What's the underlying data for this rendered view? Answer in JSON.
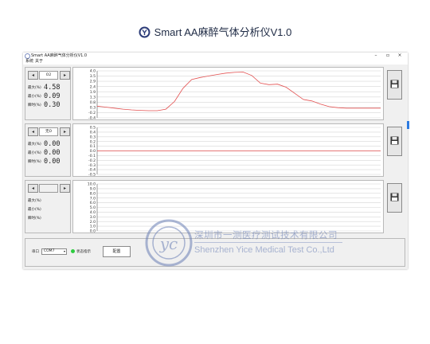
{
  "page": {
    "title": "Smart AA麻醉气体分析仪V1.0"
  },
  "window": {
    "title": "Smart AA麻醉气体分析仪V1.0",
    "controls": [
      "–",
      "▫",
      "×"
    ],
    "menu": [
      "系统",
      "关于"
    ]
  },
  "labels": {
    "max": "最大(%)",
    "min": "最小(%)",
    "instant": "瞬时(%)"
  },
  "channels": [
    {
      "gas": "O2",
      "max": "4.58",
      "min": "0.09",
      "instant": "0.30",
      "ticks": [
        "4.0",
        "3.5",
        "2.9",
        "2.4",
        "1.9",
        "1.3",
        "0.8",
        "0.3",
        "-0.2",
        "-0.4"
      ]
    },
    {
      "gas": "无O",
      "max": "0.00",
      "min": "0.00",
      "instant": "0.00",
      "ticks": [
        "0.5",
        "0.4",
        "0.3",
        "0.2",
        "0.1",
        "0.0",
        "-0.1",
        "-0.2",
        "-0.3",
        "-0.4",
        "-0.5"
      ]
    },
    {
      "gas": "",
      "max": "",
      "min": "",
      "instant": "",
      "ticks": [
        "10.0",
        "9.0",
        "8.0",
        "7.0",
        "6.0",
        "5.0",
        "4.0",
        "3.0",
        "2.0",
        "1.0",
        "0.0"
      ]
    }
  ],
  "bottom": {
    "port_label": "串口",
    "port_value": "COM7",
    "status_label": "状态指示",
    "config_label": "配置",
    "status_color": "#2ecc40"
  },
  "chart_data": [
    {
      "type": "line",
      "ylim": [
        -0.4,
        4.2
      ],
      "line_color": "#e35050",
      "series": [
        {
          "values": [
            0.75,
            0.65,
            0.55,
            0.45,
            0.38,
            0.33,
            0.3,
            0.3,
            0.45,
            1.2,
            2.5,
            3.35,
            3.55,
            3.7,
            3.85,
            3.98,
            4.05,
            4.08,
            3.75,
            3.0,
            2.85,
            2.9,
            2.6,
            2.0,
            1.4,
            1.25,
            0.95,
            0.7,
            0.6,
            0.55,
            0.55,
            0.55,
            0.55,
            0.55
          ]
        }
      ]
    },
    {
      "type": "line",
      "ylim": [
        -0.5,
        0.5
      ],
      "line_color": "#e35050",
      "series": [
        {
          "values": [
            0.0,
            0.0
          ]
        }
      ]
    },
    {
      "type": "line",
      "ylim": [
        0,
        10
      ],
      "line_color": "#e35050",
      "series": []
    }
  ],
  "watermark": {
    "cn": "深圳市一测医疗测试技术有限公司",
    "en": "Shenzhen Yice Medical Test Co.,Ltd",
    "logo_text": "yc"
  }
}
